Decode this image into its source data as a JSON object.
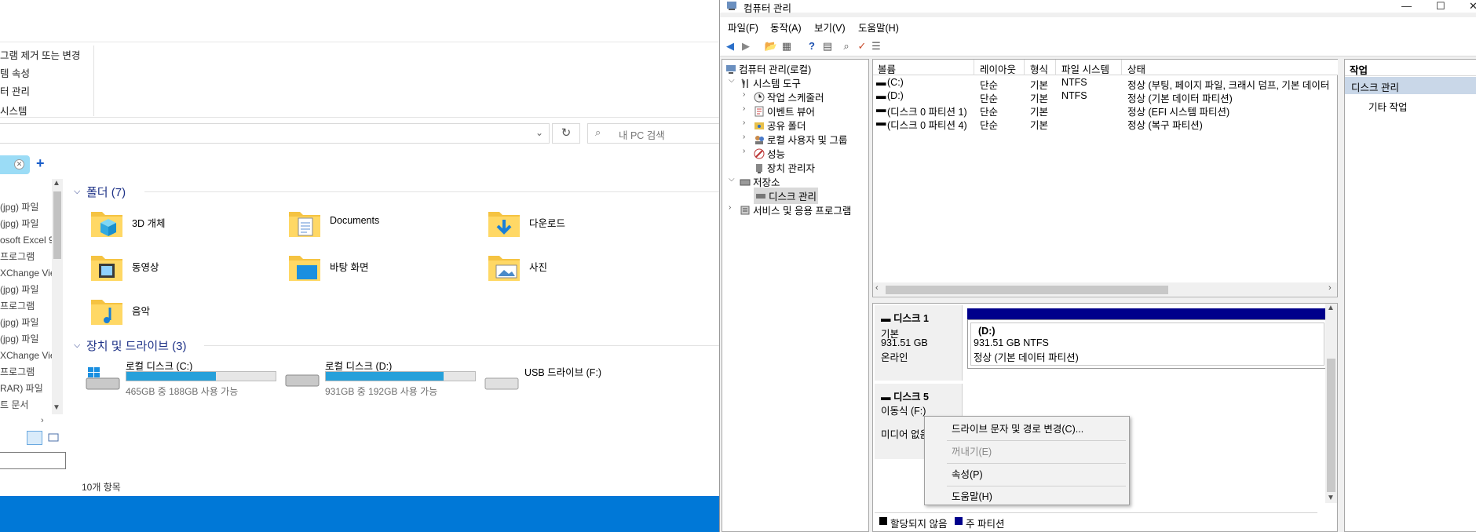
{
  "explorer": {
    "ribbon_items": [
      "그램 제거 또는 변경",
      "템 속성",
      "터 관리",
      "시스템"
    ],
    "search_placeholder": "내 PC 검색",
    "nav_items": [
      "(jpg) 파일",
      "(jpg) 파일",
      "osoft Excel 9.",
      "프로그램",
      "XChange Vie",
      "(jpg) 파일",
      "프로그램",
      "(jpg) 파일",
      "(jpg) 파일",
      "XChange Vie",
      "프로그램",
      "RAR) 파일",
      "트 문서"
    ],
    "folders_heading": "폴더 (7)",
    "folders": [
      {
        "name": "3D 개체",
        "icon": "3d-objects-folder-icon"
      },
      {
        "name": "Documents",
        "icon": "documents-folder-icon"
      },
      {
        "name": "다운로드",
        "icon": "downloads-folder-icon"
      },
      {
        "name": "동영상",
        "icon": "videos-folder-icon"
      },
      {
        "name": "바탕 화면",
        "icon": "desktop-folder-icon"
      },
      {
        "name": "사진",
        "icon": "pictures-folder-icon"
      },
      {
        "name": "음악",
        "icon": "music-folder-icon"
      }
    ],
    "drives_heading": "장치 및 드라이브 (3)",
    "drives": [
      {
        "name": "로컬 디스크 (C:)",
        "usage": "465GB 중 188GB 사용 가능",
        "used_fraction": 0.6
      },
      {
        "name": "로컬 디스크 (D:)",
        "usage": "931GB 중 192GB 사용 가능",
        "used_fraction": 0.79
      },
      {
        "name": "USB 드라이브 (F:)",
        "usage": ""
      }
    ],
    "status": "10개 항목"
  },
  "mgmt": {
    "title": "컴퓨터 관리",
    "menu": [
      "파일(F)",
      "동작(A)",
      "보기(V)",
      "도움말(H)"
    ],
    "tree": {
      "root": "컴퓨터 관리(로컬)",
      "system_tools": "시스템 도구",
      "task_scheduler": "작업 스케줄러",
      "event_viewer": "이벤트 뷰어",
      "shared_folders": "공유 폴더",
      "local_users": "로컬 사용자 및 그룹",
      "performance": "성능",
      "device_manager": "장치 관리자",
      "storage": "저장소",
      "disk_management": "디스크 관리",
      "services": "서비스 및 응용 프로그램"
    },
    "columns": [
      "볼륨",
      "레이아웃",
      "형식",
      "파일 시스템",
      "상태"
    ],
    "volumes": [
      {
        "name": "(C:)",
        "layout": "단순",
        "type": "기본",
        "fs": "NTFS",
        "status": "정상 (부팅, 페이지 파일, 크래시 덤프, 기본 데이터"
      },
      {
        "name": "(D:)",
        "layout": "단순",
        "type": "기본",
        "fs": "NTFS",
        "status": "정상 (기본 데이터 파티션)"
      },
      {
        "name": "(디스크 0 파티션 1)",
        "layout": "단순",
        "type": "기본",
        "fs": "",
        "status": "정상 (EFI 시스템 파티션)"
      },
      {
        "name": "(디스크 0 파티션 4)",
        "layout": "단순",
        "type": "기본",
        "fs": "",
        "status": "정상 (복구 파티션)"
      }
    ],
    "disk1": {
      "name": "디스크 1",
      "type": "기본",
      "size": "931.51 GB",
      "state": "온라인",
      "part_name": "(D:)",
      "part_size": "931.51 GB NTFS",
      "part_status": "정상 (기본 데이터 파티션)"
    },
    "disk5": {
      "name": "디스크 5",
      "type": "이동식 (F:)",
      "state": "미디어 없음"
    },
    "context_menu": [
      "드라이브 문자 및 경로 변경(C)...",
      "꺼내기(E)",
      "속성(P)",
      "도움말(H)"
    ],
    "legend": [
      "할당되지 않음",
      "주 파티션"
    ],
    "legend_colors": [
      "#000000",
      "#00008b"
    ],
    "actions_heading": "작업",
    "actions_selected": "디스크 관리",
    "actions_more": "기타 작업"
  }
}
